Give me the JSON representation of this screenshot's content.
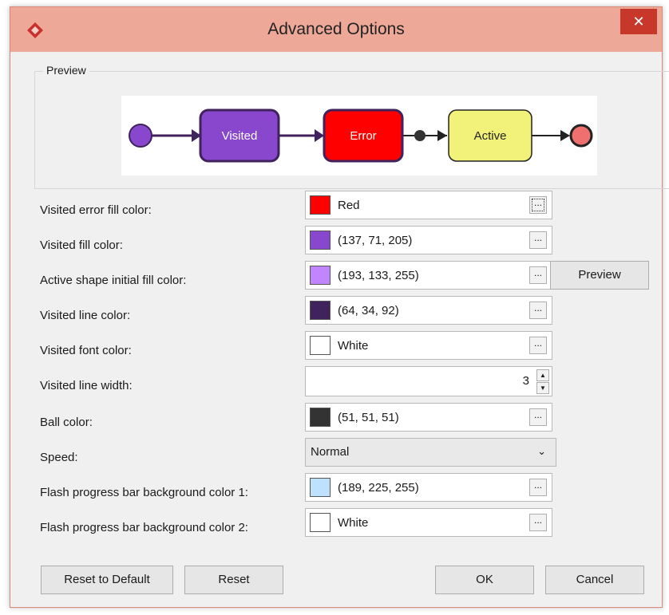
{
  "dialog": {
    "title": "Advanced Options",
    "close_symbol": "✕",
    "icons": {
      "app": "app-diamond-icon",
      "close": "close-icon"
    }
  },
  "preview": {
    "group_label": "Preview",
    "nodes": [
      {
        "label": "Visited",
        "fill": "#8947CD",
        "text_color": "#FFFFFF"
      },
      {
        "label": "Error",
        "fill": "#FF0000",
        "text_color": "#FFFFFF"
      },
      {
        "label": "Active",
        "fill": "#F2F27A",
        "text_color": "#222222"
      }
    ],
    "colors": {
      "start_node": "#8947CD",
      "end_node": "#F07070",
      "visited_line": "#40225C",
      "ball": "#333333"
    }
  },
  "options": [
    {
      "label": "Visited error fill color:",
      "value": "Red",
      "swatch": "#FF0000",
      "button": "..."
    },
    {
      "label": "Visited fill color:",
      "value": "(137, 71, 205)",
      "swatch": "#8947CD",
      "button": "..."
    },
    {
      "label": "Active shape initial fill color:",
      "value": "(193, 133, 255)",
      "swatch": "#C185FF",
      "button": "..."
    },
    {
      "label": "Visited line color:",
      "value": "(64, 34, 92)",
      "swatch": "#40225C",
      "button": "..."
    },
    {
      "label": "Visited font color:",
      "value": "White",
      "swatch": "#FFFFFF",
      "button": "..."
    },
    {
      "label": "Visited line width:",
      "value": "3",
      "type": "spinner"
    },
    {
      "label": "Ball color:",
      "value": "(51, 51, 51)",
      "swatch": "#333333",
      "button": "..."
    },
    {
      "label": "Speed:",
      "value": "Normal",
      "type": "select"
    },
    {
      "label": "Flash progress bar background color 1:",
      "value": "(189, 225, 255)",
      "swatch": "#BDE1FF",
      "button": "..."
    },
    {
      "label": "Flash progress bar background color 2:",
      "value": "White",
      "swatch": "#FFFFFF",
      "button": "..."
    }
  ],
  "side_buttons": {
    "preview": "Preview"
  },
  "footer": {
    "reset_default": "Reset to Default",
    "reset": "Reset",
    "ok": "OK",
    "cancel": "Cancel"
  },
  "theme": {
    "titlebar": "#EDA898",
    "close_button": "#C7382A"
  }
}
